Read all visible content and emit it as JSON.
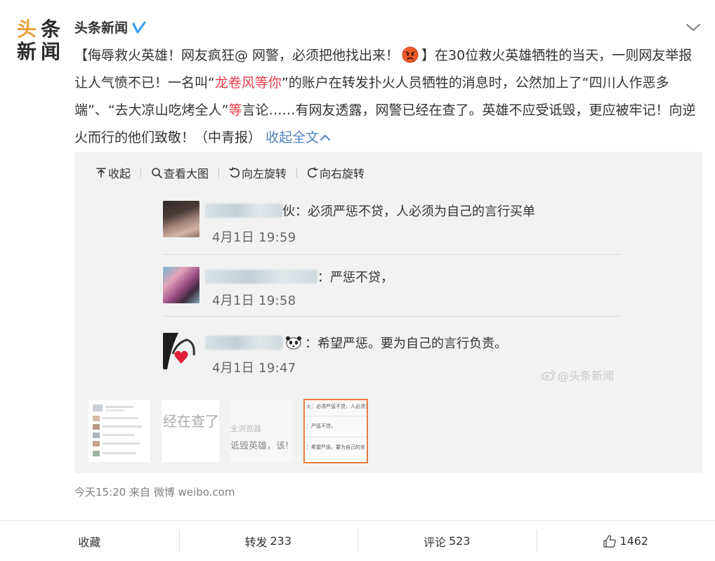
{
  "logo": {
    "line1": [
      "头",
      "条"
    ],
    "line2": [
      "新",
      "闻"
    ]
  },
  "author": {
    "name": "头条新闻",
    "verified_icon": "verified-v-icon"
  },
  "post": {
    "p1": "【侮辱救火英雄！网友疯狂@ 网警，必须把他找出来！",
    "emoji_icon": "angry-face-icon",
    "p2": "】在30位救火英雄牺牲的当天，一则网友举报让人气愤不已！一名叫“",
    "highlight1": "龙卷风等你",
    "p3": "”的账户在转发扑火人员牺牲的消息时，公然加上了“四川人作恶多端”、“去大凉山吃烤全人”",
    "highlight2": "等",
    "p4": "言论……有网友透露，网警已经在查了。英雄不应受诋毁，更应被牢记！向逆火而行的他们致敬！（中青报）",
    "collapse_link": "收起全文"
  },
  "toolbar": {
    "collapse": "收起",
    "view_large": "查看大图",
    "rotate_left": "向左旋转",
    "rotate_right": "向右旋转"
  },
  "comments": [
    {
      "name_tail": "伙：",
      "text": "必须严惩不贷，人必须为自己的言行买单",
      "time": "4月1日 19:59"
    },
    {
      "name_tail": "：",
      "text": "严惩不贷，",
      "time": "4月1日 19:58"
    },
    {
      "name_tail": "：",
      "text": "希望严惩。要为自己的言行负责。",
      "time": "4月1日 19:47"
    }
  ],
  "watermark": "@头条新闻",
  "thumbnails": {
    "t2_text1": "经在查了，",
    "t3_text1": "全浏览器",
    "t3_text2": "诋毁英雄，该!",
    "t4_lines": [
      "火：必须严惩不贷，人必须为",
      "：严惩不贷，",
      "：希望严惩。要为自己的言"
    ]
  },
  "meta": "今天15:20 来自 微博 weibo.com",
  "actions": {
    "favorite": "收藏",
    "forward_label": "转发",
    "forward_count": "233",
    "comment_label": "评论",
    "comment_count": "523",
    "like_count": "1462"
  },
  "colors": {
    "highlight": "#eb3b4a",
    "link": "#4f82bd",
    "logo_orange": "#e8a23a",
    "thumb_select": "#eb7c3c"
  }
}
